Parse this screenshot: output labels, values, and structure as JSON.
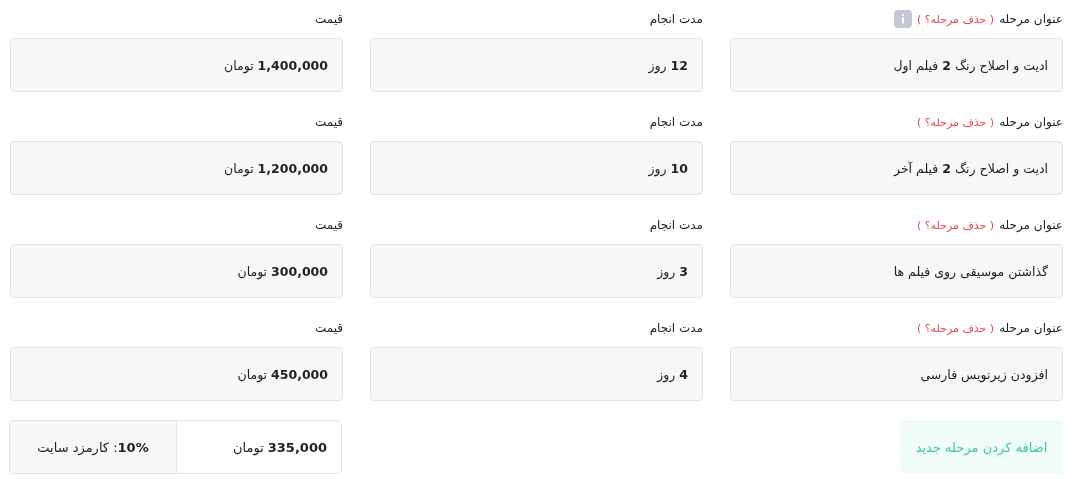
{
  "stages": [
    {
      "title_label": "عنوان مرحله",
      "delete_link": "( حذف مرحله؟ )",
      "has_info": true,
      "title": "ادیت و اصلاح رنگ **2** فیلم اول",
      "duration_label": "مدت انجام",
      "duration": "**12** روز",
      "price_label": "قیمت",
      "price": "**1,400,000** تومان"
    },
    {
      "title_label": "عنوان مرحله",
      "delete_link": "( حذف مرحله؟ )",
      "has_info": false,
      "title": "ادیت و اصلاح رنگ **2** فیلم آخر",
      "duration_label": "مدت انجام",
      "duration": "**10** روز",
      "price_label": "قیمت",
      "price": "**1,200,000** تومان"
    },
    {
      "title_label": "عنوان مرحله",
      "delete_link": "( حذف مرحله؟ )",
      "has_info": false,
      "title": "گذاشتن موسیقی روی فیلم ها",
      "duration_label": "مدت انجام",
      "duration": "**3** روز",
      "price_label": "قیمت",
      "price": "**300,000** تومان"
    },
    {
      "title_label": "عنوان مرحله",
      "delete_link": "( حذف مرحله؟ )",
      "has_info": false,
      "title": "افزودن زیرنویس فارسی",
      "duration_label": "مدت انجام",
      "duration": "**4** روز",
      "price_label": "قیمت",
      "price": "**450,000** تومان"
    }
  ],
  "add_button": "اضافه کردن مرحله جدید",
  "fee": {
    "amount": "**335,000** تومان",
    "rate": "**10%** : کارمزد سایت"
  }
}
